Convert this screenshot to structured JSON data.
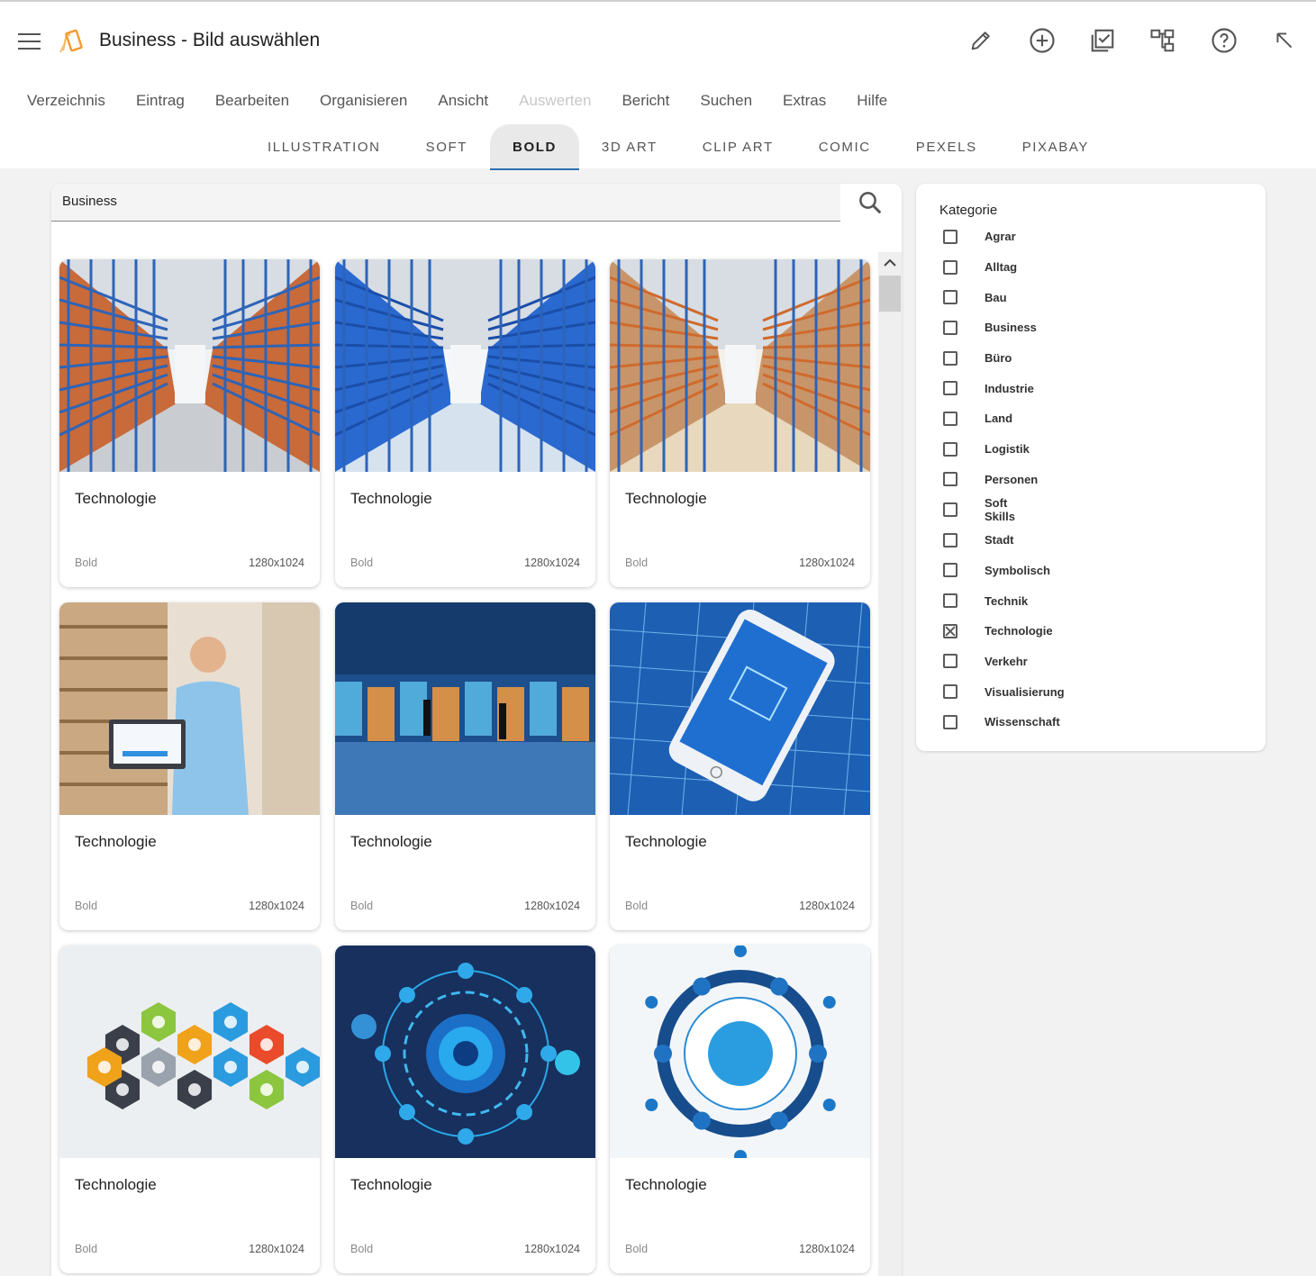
{
  "app": {
    "title": "Business - Bild auswählen"
  },
  "toolbar_icons": [
    "pencil-icon",
    "add-circle-icon",
    "checklist-icon",
    "hierarchy-icon",
    "help-icon",
    "arrow-up-left-icon"
  ],
  "menu": [
    "Verzeichnis",
    "Eintrag",
    "Bearbeiten",
    "Organisieren",
    "Ansicht",
    "Auswerten",
    "Bericht",
    "Suchen",
    "Extras",
    "Hilfe"
  ],
  "menu_disabled_index": 5,
  "tabs": [
    "Illustration",
    "Soft",
    "Bold",
    "3D Art",
    "Clip Art",
    "Comic",
    "Pexels",
    "Pixabay"
  ],
  "active_tab_index": 2,
  "search": {
    "value": "Business"
  },
  "cards": [
    {
      "title": "Technologie",
      "style": "Bold",
      "size": "1280x1024",
      "image": "warehouse-aisle"
    },
    {
      "title": "Technologie",
      "style": "Bold",
      "size": "1280x1024",
      "image": "blue-warehouse-shelves"
    },
    {
      "title": "Technologie",
      "style": "Bold",
      "size": "1280x1024",
      "image": "warehouse-boxes"
    },
    {
      "title": "Technologie",
      "style": "Bold",
      "size": "1280x1024",
      "image": "man-with-laptop"
    },
    {
      "title": "Technologie",
      "style": "Bold",
      "size": "1280x1024",
      "image": "digital-hall-people"
    },
    {
      "title": "Technologie",
      "style": "Bold",
      "size": "1280x1024",
      "image": "smartphone-blueprint"
    },
    {
      "title": "Technologie",
      "style": "Bold",
      "size": "1280x1024",
      "image": "hexagon-icons"
    },
    {
      "title": "Technologie",
      "style": "Bold",
      "size": "1280x1024",
      "image": "automation-circle-diagram"
    },
    {
      "title": "Technologie",
      "style": "Bold",
      "size": "1280x1024",
      "image": "supply-chain-diagram"
    }
  ],
  "category_panel": {
    "heading": "Kategorie",
    "items": [
      {
        "label": "Agrar",
        "checked": false
      },
      {
        "label": "Alltag",
        "checked": false
      },
      {
        "label": "Bau",
        "checked": false
      },
      {
        "label": "Business",
        "checked": false
      },
      {
        "label": "Büro",
        "checked": false
      },
      {
        "label": "Industrie",
        "checked": false
      },
      {
        "label": "Land",
        "checked": false
      },
      {
        "label": "Logistik",
        "checked": false
      },
      {
        "label": "Personen",
        "checked": false
      },
      {
        "label": "Soft Skills",
        "checked": false
      },
      {
        "label": "Stadt",
        "checked": false
      },
      {
        "label": "Symbolisch",
        "checked": false
      },
      {
        "label": "Technik",
        "checked": false
      },
      {
        "label": "Technologie",
        "checked": true
      },
      {
        "label": "Verkehr",
        "checked": false
      },
      {
        "label": "Visualisierung",
        "checked": false
      },
      {
        "label": "Wissenschaft",
        "checked": false
      }
    ]
  },
  "colors": {
    "accent": "#2f6fb1",
    "logo": "#f5a23b"
  }
}
